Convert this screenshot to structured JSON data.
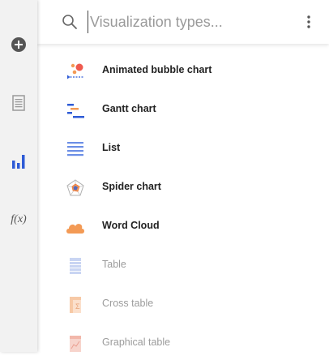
{
  "rail": {
    "items": [
      {
        "name": "add-icon"
      },
      {
        "name": "document-icon"
      },
      {
        "name": "bar-chart-icon"
      },
      {
        "name": "function-icon",
        "text": "f(x)"
      }
    ]
  },
  "search": {
    "placeholder": "Visualization types...",
    "value": ""
  },
  "menu": {
    "icon": "more-vertical-icon"
  },
  "visualizations": [
    {
      "label": "Animated bubble chart",
      "icon": "animated-bubble-chart-icon",
      "enabled": true
    },
    {
      "label": "Gantt chart",
      "icon": "gantt-chart-icon",
      "enabled": true
    },
    {
      "label": "List",
      "icon": "list-icon",
      "enabled": true
    },
    {
      "label": "Spider chart",
      "icon": "spider-chart-icon",
      "enabled": true
    },
    {
      "label": "Word Cloud",
      "icon": "word-cloud-icon",
      "enabled": true
    },
    {
      "label": "Table",
      "icon": "table-icon",
      "enabled": false
    },
    {
      "label": "Cross table",
      "icon": "cross-table-icon",
      "enabled": false
    },
    {
      "label": "Graphical table",
      "icon": "graphical-table-icon",
      "enabled": false
    }
  ],
  "colors": {
    "accent": "#2e5bd6",
    "orange": "#f39a55",
    "disabled_label": "#9c9c9c"
  }
}
